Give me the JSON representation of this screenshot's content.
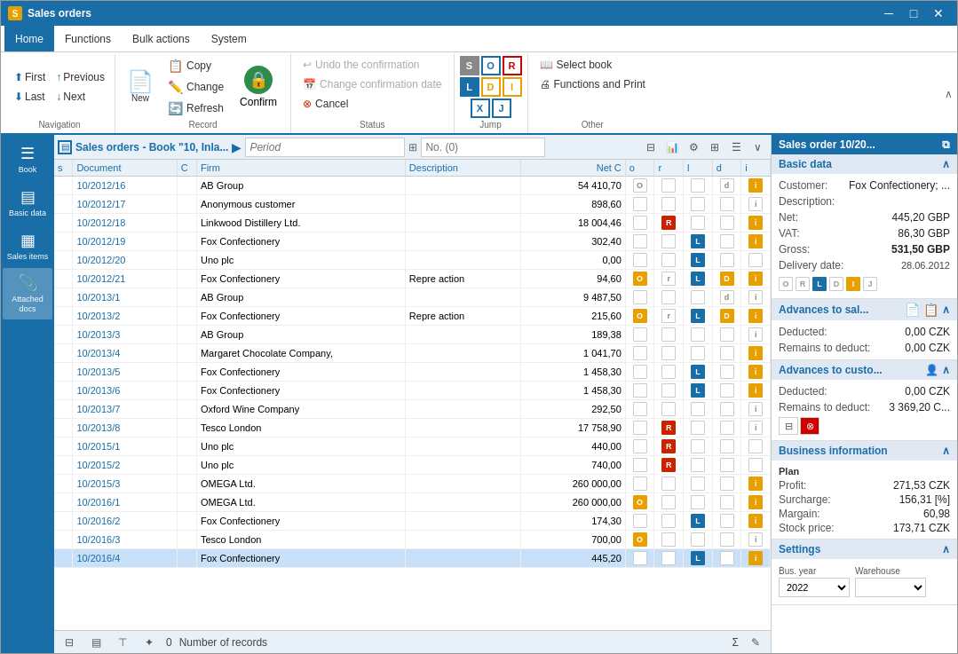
{
  "window": {
    "title": "Sales orders",
    "icon": "S"
  },
  "menu": {
    "items": [
      {
        "id": "home",
        "label": "Home",
        "active": true
      },
      {
        "id": "functions",
        "label": "Functions"
      },
      {
        "id": "bulk",
        "label": "Bulk actions"
      },
      {
        "id": "system",
        "label": "System"
      }
    ]
  },
  "ribbon": {
    "navigation": {
      "label": "Navigation",
      "first": "First",
      "last": "Last",
      "previous": "Previous",
      "next": "Next"
    },
    "record": {
      "label": "Record",
      "new_label": "New",
      "copy_label": "Copy",
      "change_label": "Change",
      "refresh_label": "Refresh",
      "confirm_label": "Confirm"
    },
    "status": {
      "label": "Status",
      "undo_confirmation": "Undo the confirmation",
      "change_confirmation_date": "Change confirmation date",
      "cancel": "Cancel"
    },
    "jump": {
      "label": "Jump",
      "s": "S",
      "o": "O",
      "r": "R",
      "l": "L",
      "d": "D",
      "i": "I",
      "x": "X",
      "j": "J"
    },
    "other": {
      "label": "Other",
      "select_book": "Select book",
      "functions_print": "Functions and Print"
    },
    "collapse_label": "^"
  },
  "sidebar": {
    "items": [
      {
        "id": "book",
        "label": "Book",
        "icon": "☰"
      },
      {
        "id": "basic",
        "label": "Basic data",
        "icon": "▤"
      },
      {
        "id": "sales",
        "label": "Sales items",
        "icon": "▦"
      },
      {
        "id": "attached",
        "label": "Attached docs",
        "icon": "📎"
      }
    ]
  },
  "list": {
    "title": "Sales orders - Book \"10, Inla...",
    "period_placeholder": "Period",
    "no_placeholder": "No. (0)",
    "columns": [
      "s",
      "Document",
      "C",
      "Firm",
      "Description",
      "Net C",
      "o",
      "r",
      "l",
      "d",
      "i"
    ],
    "rows": [
      {
        "doc": "10/2012/16",
        "firm": "AB Group",
        "desc": "",
        "net": "54 410,70",
        "o": "O",
        "r": "",
        "l": "",
        "d": "d",
        "i": "i",
        "oFill": false,
        "rFill": false,
        "lFill": false,
        "dFill": false,
        "iFill": true
      },
      {
        "doc": "10/2012/17",
        "firm": "Anonymous customer",
        "desc": "",
        "net": "898,60",
        "o": "",
        "r": "",
        "l": "",
        "d": "",
        "i": "i",
        "oFill": false,
        "rFill": false,
        "lFill": false,
        "dFill": false,
        "iFill": false
      },
      {
        "doc": "10/2012/18",
        "firm": "Linkwood Distillery Ltd.",
        "desc": "",
        "net": "18 004,46",
        "o": "",
        "r": "R",
        "l": "",
        "d": "",
        "i": "i",
        "oFill": false,
        "rFill": true,
        "lFill": false,
        "dFill": false,
        "iFill": true
      },
      {
        "doc": "10/2012/19",
        "firm": "Fox Confectionery",
        "desc": "",
        "net": "302,40",
        "o": "",
        "r": "",
        "l": "L",
        "d": "",
        "i": "i",
        "oFill": false,
        "rFill": false,
        "lFill": true,
        "dFill": false,
        "iFill": true
      },
      {
        "doc": "10/2012/20",
        "firm": "Uno plc",
        "desc": "",
        "net": "0,00",
        "o": "",
        "r": "",
        "l": "L",
        "d": "",
        "i": "",
        "oFill": false,
        "rFill": false,
        "lFill": true,
        "dFill": false,
        "iFill": false
      },
      {
        "doc": "10/2012/21",
        "firm": "Fox Confectionery",
        "desc": "Repre action",
        "net": "94,60",
        "o": "O",
        "r": "r",
        "l": "L",
        "d": "D",
        "i": "i",
        "oFill": true,
        "rFill": false,
        "lFill": true,
        "dFill": true,
        "iFill": true
      },
      {
        "doc": "10/2013/1",
        "firm": "AB Group",
        "desc": "",
        "net": "9 487,50",
        "o": "",
        "r": "",
        "l": "",
        "d": "d",
        "i": "i",
        "oFill": false,
        "rFill": false,
        "lFill": false,
        "dFill": false,
        "iFill": false
      },
      {
        "doc": "10/2013/2",
        "firm": "Fox Confectionery",
        "desc": "Repre action",
        "net": "215,60",
        "o": "O",
        "r": "r",
        "l": "L",
        "d": "D",
        "i": "i",
        "oFill": true,
        "rFill": false,
        "lFill": true,
        "dFill": true,
        "iFill": true
      },
      {
        "doc": "10/2013/3",
        "firm": "AB Group",
        "desc": "",
        "net": "189,38",
        "o": "",
        "r": "",
        "l": "",
        "d": "",
        "i": "i",
        "oFill": false,
        "rFill": false,
        "lFill": false,
        "dFill": false,
        "iFill": false
      },
      {
        "doc": "10/2013/4",
        "firm": "Margaret Chocolate Company,",
        "desc": "",
        "net": "1 041,70",
        "o": "",
        "r": "",
        "l": "",
        "d": "",
        "i": "i",
        "oFill": false,
        "rFill": false,
        "lFill": false,
        "dFill": false,
        "iFill": true
      },
      {
        "doc": "10/2013/5",
        "firm": "Fox Confectionery",
        "desc": "",
        "net": "1 458,30",
        "o": "",
        "r": "",
        "l": "L",
        "d": "",
        "i": "i",
        "oFill": false,
        "rFill": false,
        "lFill": true,
        "dFill": false,
        "iFill": true
      },
      {
        "doc": "10/2013/6",
        "firm": "Fox Confectionery",
        "desc": "",
        "net": "1 458,30",
        "o": "",
        "r": "",
        "l": "L",
        "d": "",
        "i": "i",
        "oFill": false,
        "rFill": false,
        "lFill": true,
        "dFill": false,
        "iFill": true
      },
      {
        "doc": "10/2013/7",
        "firm": "Oxford Wine Company",
        "desc": "",
        "net": "292,50",
        "o": "",
        "r": "",
        "l": "",
        "d": "",
        "i": "i",
        "oFill": false,
        "rFill": false,
        "lFill": false,
        "dFill": false,
        "iFill": false
      },
      {
        "doc": "10/2013/8",
        "firm": "Tesco London",
        "desc": "",
        "net": "17 758,90",
        "o": "",
        "r": "R",
        "l": "",
        "d": "",
        "i": "i",
        "oFill": false,
        "rFill": true,
        "lFill": false,
        "dFill": false,
        "iFill": false
      },
      {
        "doc": "10/2015/1",
        "firm": "Uno plc",
        "desc": "",
        "net": "440,00",
        "o": "",
        "r": "R",
        "l": "",
        "d": "",
        "i": "",
        "oFill": false,
        "rFill": true,
        "lFill": false,
        "dFill": false,
        "iFill": false
      },
      {
        "doc": "10/2015/2",
        "firm": "Uno plc",
        "desc": "",
        "net": "740,00",
        "o": "",
        "r": "R",
        "l": "",
        "d": "",
        "i": "",
        "oFill": false,
        "rFill": true,
        "lFill": false,
        "dFill": false,
        "iFill": false
      },
      {
        "doc": "10/2015/3",
        "firm": "OMEGA Ltd.",
        "desc": "",
        "net": "260 000,00",
        "o": "",
        "r": "",
        "l": "",
        "d": "",
        "i": "i",
        "oFill": false,
        "rFill": false,
        "lFill": false,
        "dFill": false,
        "iFill": true
      },
      {
        "doc": "10/2016/1",
        "firm": "OMEGA Ltd.",
        "desc": "",
        "net": "260 000,00",
        "o": "O",
        "r": "",
        "l": "",
        "d": "",
        "i": "i",
        "oFill": true,
        "rFill": false,
        "lFill": false,
        "dFill": false,
        "iFill": true
      },
      {
        "doc": "10/2016/2",
        "firm": "Fox Confectionery",
        "desc": "",
        "net": "174,30",
        "o": "",
        "r": "",
        "l": "L",
        "d": "",
        "i": "i",
        "oFill": false,
        "rFill": false,
        "lFill": true,
        "dFill": false,
        "iFill": true
      },
      {
        "doc": "10/2016/3",
        "firm": "Tesco London",
        "desc": "",
        "net": "700,00",
        "o": "O",
        "r": "",
        "l": "",
        "d": "",
        "i": "i",
        "oFill": true,
        "rFill": false,
        "lFill": false,
        "dFill": false,
        "iFill": false
      },
      {
        "doc": "10/2016/4",
        "firm": "Fox Confectionery",
        "desc": "",
        "net": "445,20",
        "o": "",
        "r": "",
        "l": "L",
        "d": "",
        "i": "i",
        "oFill": false,
        "rFill": false,
        "lFill": true,
        "dFill": false,
        "iFill": true,
        "selected": true
      }
    ],
    "footer": {
      "records_label": "Number of records"
    }
  },
  "right_panel": {
    "title": "Sales order 10/20...",
    "basic_data": {
      "label": "Basic data",
      "customer_label": "Customer:",
      "customer_value": "Fox Confectionery; ...",
      "description_label": "Description:",
      "net_label": "Net:",
      "net_value": "445,20 GBP",
      "vat_label": "VAT:",
      "vat_value": "86,30 GBP",
      "gross_label": "Gross:",
      "gross_value": "531,50 GBP",
      "delivery_label": "Delivery date:",
      "delivery_value": "28.06.2012"
    },
    "advances_sal": {
      "label": "Advances to sal...",
      "deducted_label": "Deducted:",
      "deducted_value": "0,00 CZK",
      "remains_label": "Remains to deduct:",
      "remains_value": "0,00 CZK"
    },
    "advances_cust": {
      "label": "Advances to custo...",
      "deducted_label": "Deducted:",
      "deducted_value": "0,00 CZK",
      "remains_label": "Remains to deduct:",
      "remains_value": "3 369,20 C..."
    },
    "business": {
      "label": "Business information",
      "plan_label": "Plan",
      "profit_label": "Profit:",
      "profit_value": "271,53 CZK",
      "surcharge_label": "Surcharge:",
      "surcharge_value": "156,31 [%]",
      "margin_label": "Margain:",
      "margin_value": "60,98",
      "stock_label": "Stock price:",
      "stock_value": "173,71 CZK"
    },
    "settings": {
      "label": "Settings",
      "bus_year_label": "Bus. year",
      "bus_year_value": "2022",
      "warehouse_label": "Warehouse"
    }
  }
}
